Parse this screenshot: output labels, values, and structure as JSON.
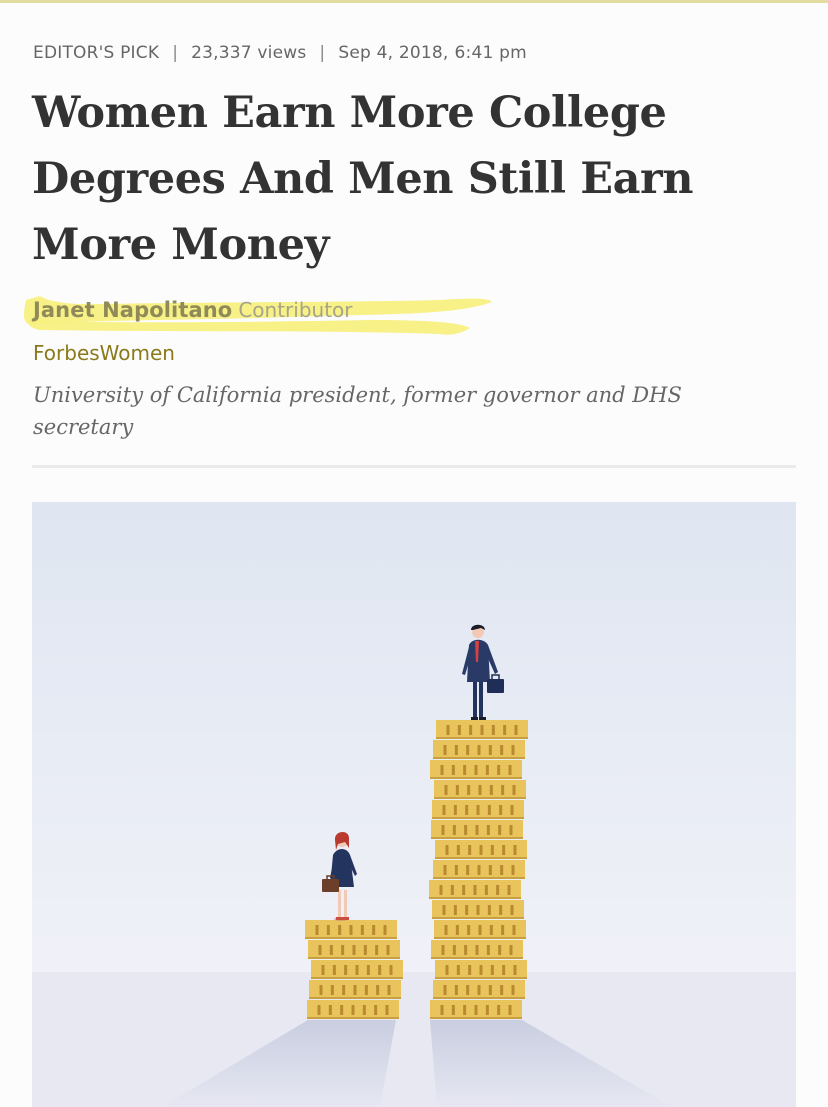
{
  "meta": {
    "section": "EDITOR'S PICK",
    "separator": "|",
    "views": "23,337 views",
    "date": "Sep 4, 2018,",
    "time": "6:41 pm"
  },
  "article": {
    "headline": "Women Earn More College Degrees And Men Still Earn More Money"
  },
  "byline": {
    "author": "Janet Napolitano",
    "role": "Contributor",
    "channel": "ForbesWomen",
    "bio": "University of California president, former governor and DHS secretary"
  },
  "colors": {
    "highlight": "#f6f07a",
    "channel": "#8a7a1c",
    "coin": "#e9c35c",
    "suit": "#2a3a66"
  },
  "hero_image": {
    "description_icon": "coin-stacks-illustration",
    "left_stack_coins": 5,
    "right_stack_coins": 15
  }
}
